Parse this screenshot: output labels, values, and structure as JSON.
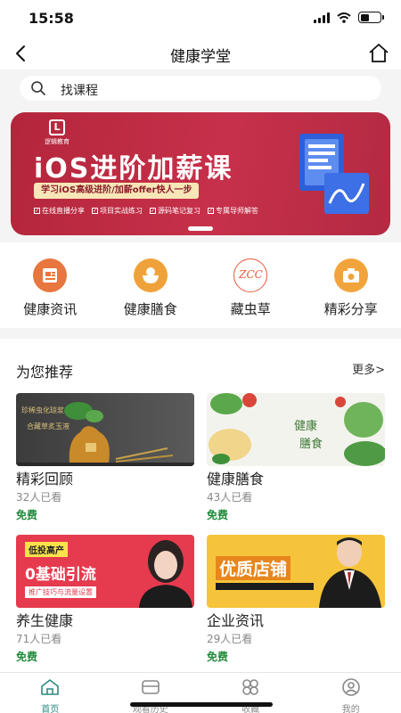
{
  "status_bar": {
    "time": "15:58"
  },
  "nav": {
    "title": "健康学堂"
  },
  "search": {
    "placeholder": "找课程"
  },
  "banner": {
    "logo_text": "逻辑教育",
    "title": "iOS进阶加薪课",
    "subtitle": "学习iOS高级进阶/加薪offer快人一步",
    "features": [
      "在线直播分享",
      "项目实战练习",
      "源码笔记复习",
      "专属导师解答"
    ]
  },
  "categories": [
    {
      "label": "健康资讯",
      "icon": "news-icon",
      "color": "#e8763f"
    },
    {
      "label": "健康膳食",
      "icon": "rice-bowl-icon",
      "color": "#f0a23a"
    },
    {
      "label": "藏虫草",
      "icon": "cordyceps-logo-icon",
      "color": "#e85a3a"
    },
    {
      "label": "精彩分享",
      "icon": "camera-icon",
      "color": "#f2a43c"
    }
  ],
  "recommend": {
    "title": "为您推荐",
    "more": "更多>",
    "cards": [
      {
        "title": "精彩回顾",
        "views": "32人已看",
        "price": "免费",
        "art_lines": [
          "珍稀虫化琼浆",
          "合藏草炙玉液"
        ]
      },
      {
        "title": "健康膳食",
        "views": "43人已看",
        "price": "免费",
        "art_lines": [
          "健康",
          "膳食"
        ]
      },
      {
        "title": "养生健康",
        "views": "71人已看",
        "price": "免费",
        "art_lines": [
          "低投高产",
          "0基础引流",
          "推广技巧与流量设置"
        ]
      },
      {
        "title": "企业资讯",
        "views": "29人已看",
        "price": "免费",
        "art_lines": [
          "优质店铺"
        ]
      }
    ]
  },
  "tabs": [
    {
      "label": "首页",
      "icon": "home-icon",
      "active": true
    },
    {
      "label": "观看历史",
      "icon": "history-icon",
      "active": false
    },
    {
      "label": "收藏",
      "icon": "collect-icon",
      "active": false
    },
    {
      "label": "我的",
      "icon": "profile-icon",
      "active": false
    }
  ],
  "colors": {
    "accent": "#2a8a84",
    "free": "#1f8a3a",
    "banner": "#c7304a"
  }
}
